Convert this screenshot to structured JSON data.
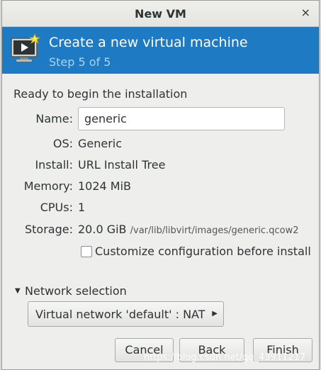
{
  "window": {
    "title": "New VM",
    "close_glyph": "×"
  },
  "banner": {
    "title": "Create a new virtual machine",
    "step": "Step 5 of 5",
    "icon": "vm-install-icon"
  },
  "summary": {
    "heading": "Ready to begin the installation",
    "name_label": "Name:",
    "name_value": "generic",
    "os_label": "OS:",
    "os_value": "Generic",
    "install_label": "Install:",
    "install_value": "URL Install Tree",
    "memory_label": "Memory:",
    "memory_value": "1024 MiB",
    "cpus_label": "CPUs:",
    "cpus_value": "1",
    "storage_label": "Storage:",
    "storage_size": "20.0 GiB",
    "storage_path": "/var/lib/libvirt/images/generic.qcow2",
    "customize_label": "Customize configuration before install",
    "customize_checked": false
  },
  "network": {
    "expander_label": "Network selection",
    "expanded": true,
    "selected": "Virtual network 'default' : NAT"
  },
  "buttons": {
    "cancel": "Cancel",
    "back": "Back",
    "finish": "Finish"
  },
  "watermark": "https://blog.csdn.net/qq_43911217"
}
